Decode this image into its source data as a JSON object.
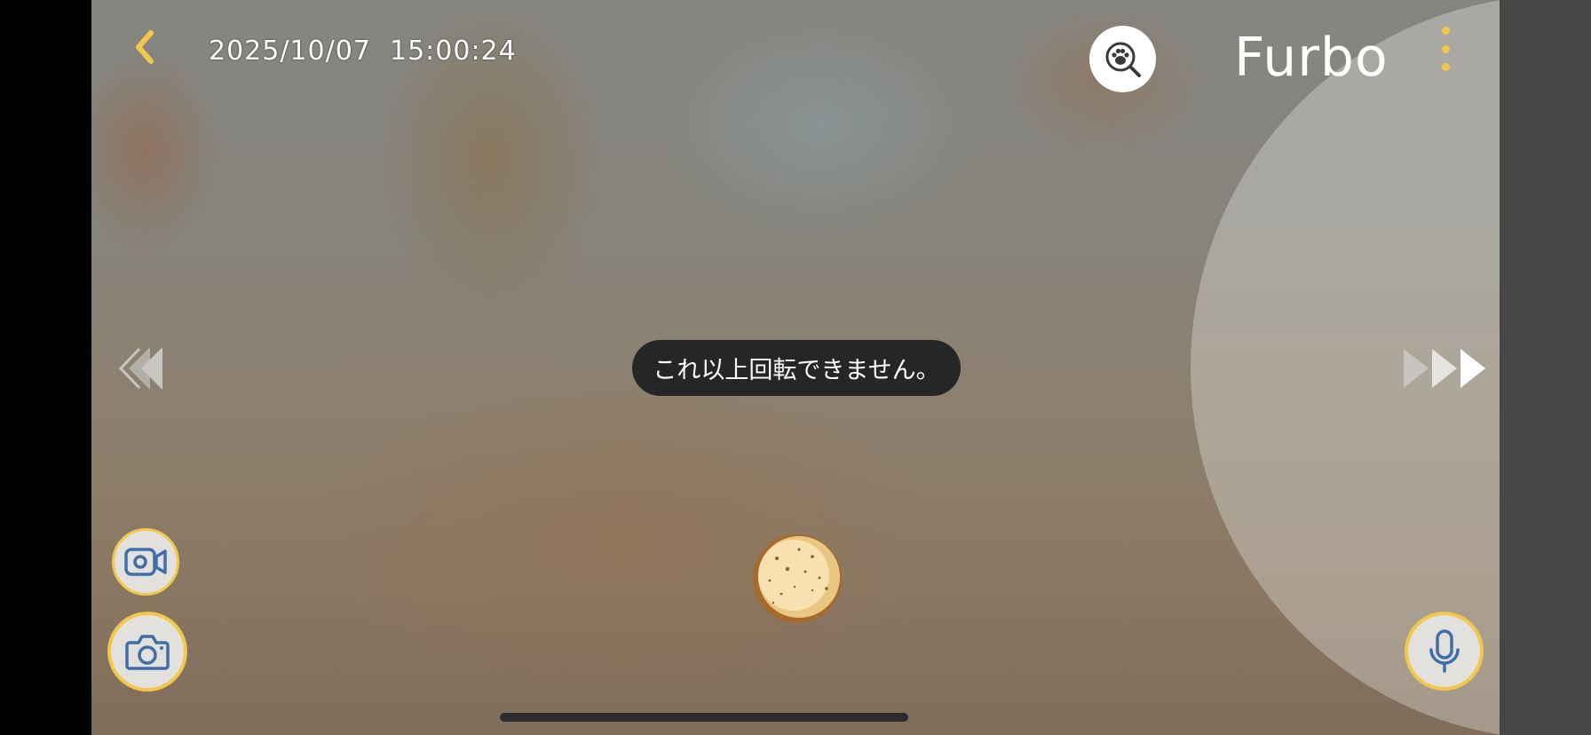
{
  "header": {
    "timestamp": "2025/10/07  15:00:24",
    "brand": "Furbo"
  },
  "toast": {
    "message": "これ以上回転できません。"
  },
  "icons": {
    "back": "chevron-left-icon",
    "paw_search": "paw-search-icon",
    "menu": "more-vertical-icon",
    "rotate_left": "double-chevron-left-icon",
    "rotate_right": "triple-chevron-right-icon",
    "treat": "treat-ball-icon",
    "record": "video-camera-icon",
    "snapshot": "camera-icon",
    "mic": "microphone-icon"
  },
  "colors": {
    "accent": "#f2c84b",
    "icon_blue": "#3f6fa6",
    "toast_bg": "#262626",
    "button_bg": "#e3e1de"
  }
}
